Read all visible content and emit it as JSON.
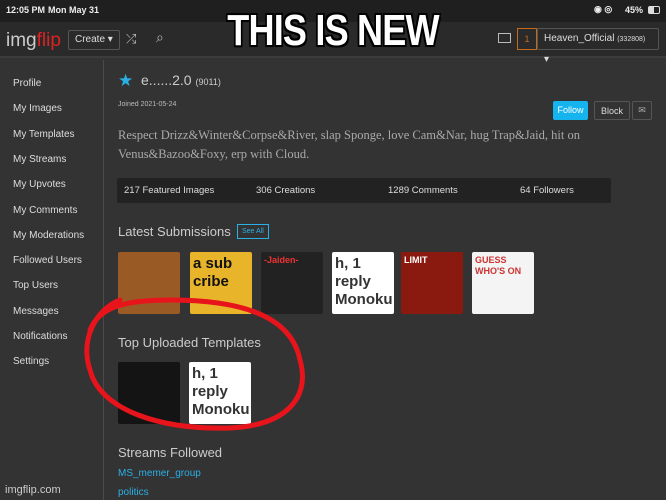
{
  "status": {
    "time": "12:05 PM",
    "date": "Mon May 31",
    "battery": "45%"
  },
  "header": {
    "logo_main": "img",
    "logo_accent": "flip",
    "create": "Create ▾",
    "shuffle_icon": "shuffle-icon",
    "search_icon": "search-icon",
    "notif_count": "1",
    "username": "Heaven_Official",
    "user_points": "(332808)",
    "dropdown": "▾"
  },
  "caption": "THIS IS NEW",
  "sidebar": {
    "items": [
      {
        "label": "Profile"
      },
      {
        "label": "My Images"
      },
      {
        "label": "My Templates"
      },
      {
        "label": "My Streams"
      },
      {
        "label": "My Upvotes"
      },
      {
        "label": "My Comments"
      },
      {
        "label": "My Moderations"
      },
      {
        "label": "Followed Users"
      },
      {
        "label": "Top Users"
      },
      {
        "label": "Messages"
      },
      {
        "label": "Notifications"
      },
      {
        "label": "Settings"
      }
    ],
    "footer": "imgflip.com"
  },
  "profile": {
    "name": "e......2.0",
    "points": "(9011)",
    "joined": "Joined 2021-05-24",
    "follow": "Follow",
    "block": "Block",
    "bio": "Respect Drizz&Winter&Corpse&River, slap Sponge, love Cam&Nar, hug Trap&Jaid, hit on Venus&Bazoo&Foxy, erp with Cloud.",
    "stats": [
      "217 Featured Images",
      "306 Creations",
      "1289 Comments",
      "64 Followers"
    ]
  },
  "latest": {
    "title": "Latest Submissions",
    "see_all": "See All",
    "thumbs": [
      {
        "text": ""
      },
      {
        "text": "a sub cribe"
      },
      {
        "text": "-Jaiden-"
      },
      {
        "text": "h, 1 reply Monoku"
      },
      {
        "text": "LIMIT"
      },
      {
        "text": "GUESS WHO'S ON"
      }
    ]
  },
  "templates": {
    "title": "Top Uploaded Templates",
    "thumbs": [
      {
        "text": ""
      },
      {
        "text": "h, 1 reply Monoku"
      }
    ]
  },
  "streams": {
    "title": "Streams Followed",
    "items": [
      "MS_memer_group",
      "politics"
    ]
  },
  "colors": {
    "accent": "#2ab0e6",
    "logo_red": "#d22222",
    "circle": "#e8141c"
  }
}
